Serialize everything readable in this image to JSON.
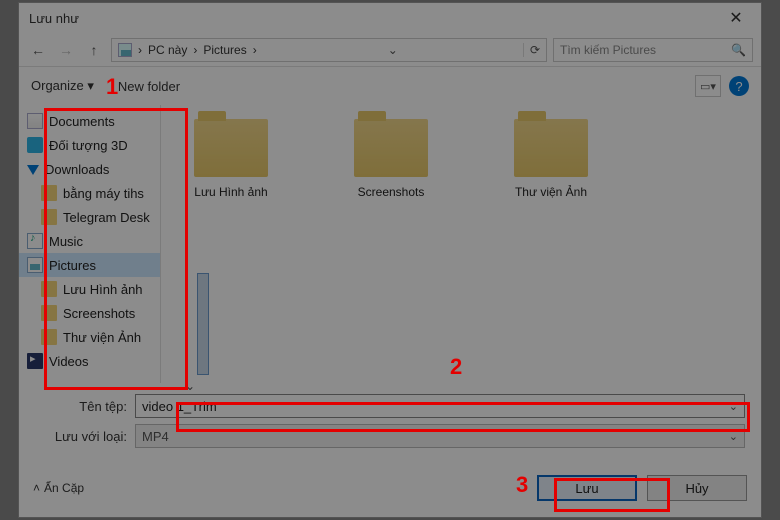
{
  "title": "Lưu như",
  "breadcrumb": {
    "root": "PC này",
    "folder": "Pictures",
    "sep": "›"
  },
  "search": {
    "placeholder": "Tìm kiếm Pictures"
  },
  "toolbar": {
    "organize": "Organize",
    "newfolder": "New folder"
  },
  "sidebar": {
    "items": [
      {
        "label": "Documents",
        "cls": "doc"
      },
      {
        "label": "Đối tượng 3D",
        "cls": "obj3d"
      },
      {
        "label": "Downloads",
        "cls": "dl"
      },
      {
        "label": "bằng máy tihs",
        "cls": "fold",
        "sub": true
      },
      {
        "label": "Telegram Desk",
        "cls": "fold",
        "sub": true
      },
      {
        "label": "Music",
        "cls": "music"
      },
      {
        "label": "Pictures",
        "cls": "pic",
        "sel": true
      },
      {
        "label": "Lưu Hình ảnh",
        "cls": "fold",
        "sub": true
      },
      {
        "label": "Screenshots",
        "cls": "fold",
        "sub": true
      },
      {
        "label": "Thư viện Ảnh",
        "cls": "fold",
        "sub": true
      },
      {
        "label": "Videos",
        "cls": "vid"
      }
    ]
  },
  "folders": [
    {
      "label": "Lưu Hình ảnh"
    },
    {
      "label": "Screenshots"
    },
    {
      "label": "Thư viện Ảnh"
    }
  ],
  "form": {
    "filename_label": "Tên tệp:",
    "filename_value": "video 1_Trim",
    "type_label": "Lưu với loại:",
    "type_value": "MP4"
  },
  "footer": {
    "hide": "Ẩn Cặp",
    "save": "Lưu",
    "cancel": "Hủy"
  },
  "annotations": {
    "n1": "1",
    "n2": "2",
    "n3": "3"
  }
}
